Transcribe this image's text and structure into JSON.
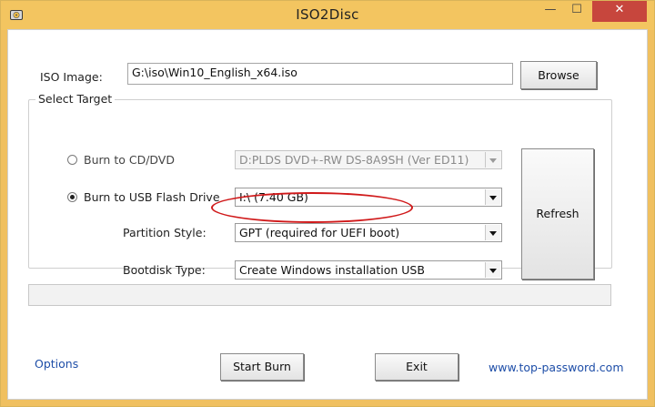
{
  "window": {
    "title": "ISO2Disc"
  },
  "title_buttons": {
    "minimize": "—",
    "maximize": "☐",
    "close": "✕"
  },
  "iso": {
    "label": "ISO Image:",
    "value": "G:\\iso\\Win10_English_x64.iso",
    "browse": "Browse"
  },
  "target": {
    "group_title": "Select Target",
    "cd": {
      "label": "Burn to CD/DVD",
      "selected": false,
      "device": "D:PLDS DVD+-RW DS-8A9SH (Ver ED11)"
    },
    "usb": {
      "label": "Burn to USB Flash Drive",
      "selected": true,
      "drive": "I:\\ (7.40 GB)"
    },
    "partition": {
      "label": "Partition Style:",
      "value": "GPT (required for UEFI boot)"
    },
    "bootdisk": {
      "label": "Bootdisk Type:",
      "value": "Create Windows installation USB"
    },
    "refresh": "Refresh"
  },
  "progress": 0,
  "footer": {
    "options": "Options",
    "start": "Start Burn",
    "exit": "Exit",
    "website": "www.top-password.com"
  },
  "colors": {
    "titlebar": "#f3c560",
    "close": "#c7463d",
    "highlight_oval": "#d0191a",
    "link": "#1e4ea8"
  },
  "icons": {
    "app": "disc-icon"
  }
}
